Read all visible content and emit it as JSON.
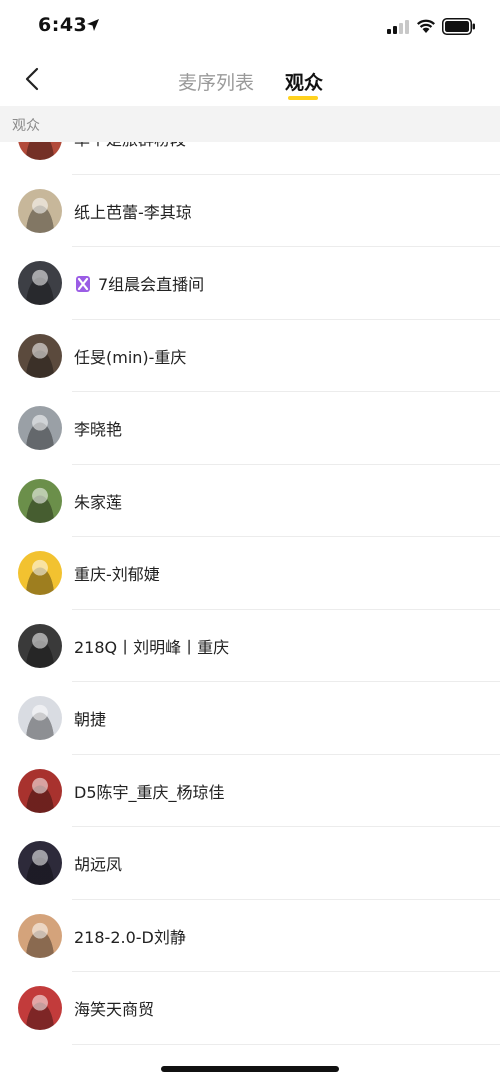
{
  "status_bar": {
    "time": "6:43"
  },
  "nav": {
    "tabs": [
      {
        "label": "麦序列表",
        "active": false
      },
      {
        "label": "观众",
        "active": true
      }
    ],
    "accent_color": "#ffd21f"
  },
  "section_header": "观众",
  "audience": [
    {
      "name": "单个是旅群粉段",
      "avatar_color": "#b24a3a"
    },
    {
      "name": "纸上芭蕾-李其琼",
      "avatar_color": "#c7b79a"
    },
    {
      "name": "7组晨会直播间",
      "avatar_color": "#3d3f45",
      "badge_icon": "purple-ribbon-icon"
    },
    {
      "name": "任旻(min)-重庆",
      "avatar_color": "#5b4a3d"
    },
    {
      "name": "李晓艳",
      "avatar_color": "#9aa0a6"
    },
    {
      "name": "朱家莲",
      "avatar_color": "#6b8f4a"
    },
    {
      "name": "重庆-刘郁婕",
      "avatar_color": "#f2c230"
    },
    {
      "name": "218Q丨刘明峰丨重庆",
      "avatar_color": "#3a3a3a"
    },
    {
      "name": "朝捷",
      "avatar_color": "#d9dce2"
    },
    {
      "name": "D5陈宇_重庆_杨琼佳",
      "avatar_color": "#a8322e"
    },
    {
      "name": "胡远凤",
      "avatar_color": "#2d2a3a"
    },
    {
      "name": "218-2.0-D刘静",
      "avatar_color": "#d4a37b"
    },
    {
      "name": "海笑天商贸",
      "avatar_color": "#c23b3b"
    }
  ]
}
